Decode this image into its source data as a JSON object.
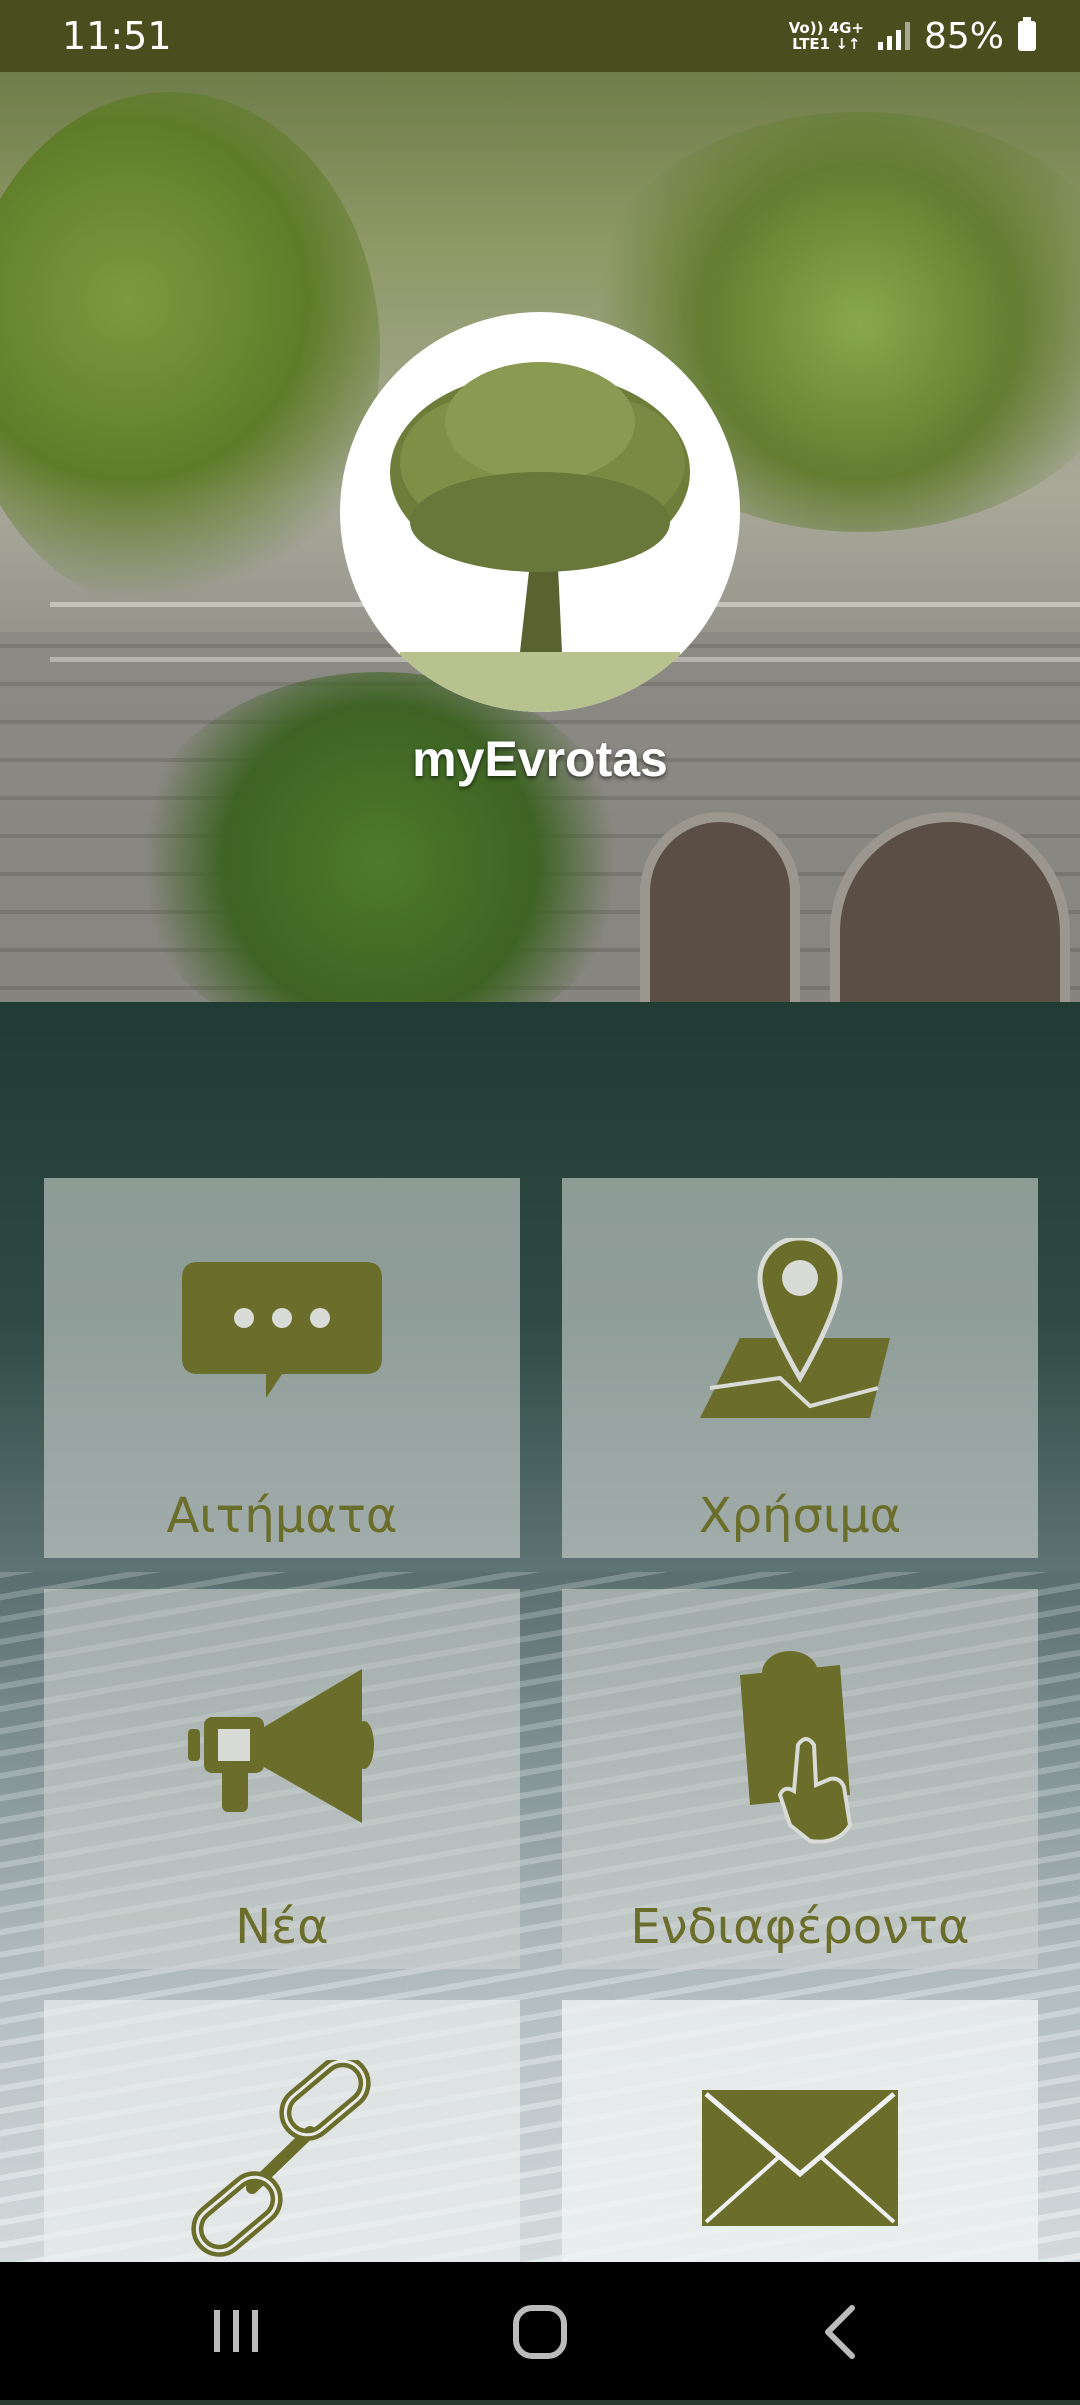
{
  "status_bar": {
    "time": "11:51",
    "network_line1": "Vo)) 4G+",
    "network_line2": "LTE1 ↓↑",
    "battery": "85%"
  },
  "app": {
    "title": "myEvrotas",
    "logo_icon": "oak-tree-logo"
  },
  "tiles": [
    {
      "label": "Αιτήματα",
      "icon": "chat-bubble-icon"
    },
    {
      "label": "Χρήσιμα",
      "icon": "map-pin-icon"
    },
    {
      "label": "Νέα",
      "icon": "megaphone-icon"
    },
    {
      "label": "Ενδιαφέροντα",
      "icon": "hand-pointer-document-icon"
    },
    {
      "label": "",
      "icon": "link-chain-icon"
    },
    {
      "label": "",
      "icon": "envelope-icon"
    }
  ],
  "colors": {
    "accent": "#6b6e2a",
    "status_bar": "#4a4d1e",
    "nav_bar": "#000000"
  },
  "nav": {
    "recents": "recents-icon",
    "home": "home-icon",
    "back": "back-icon"
  }
}
